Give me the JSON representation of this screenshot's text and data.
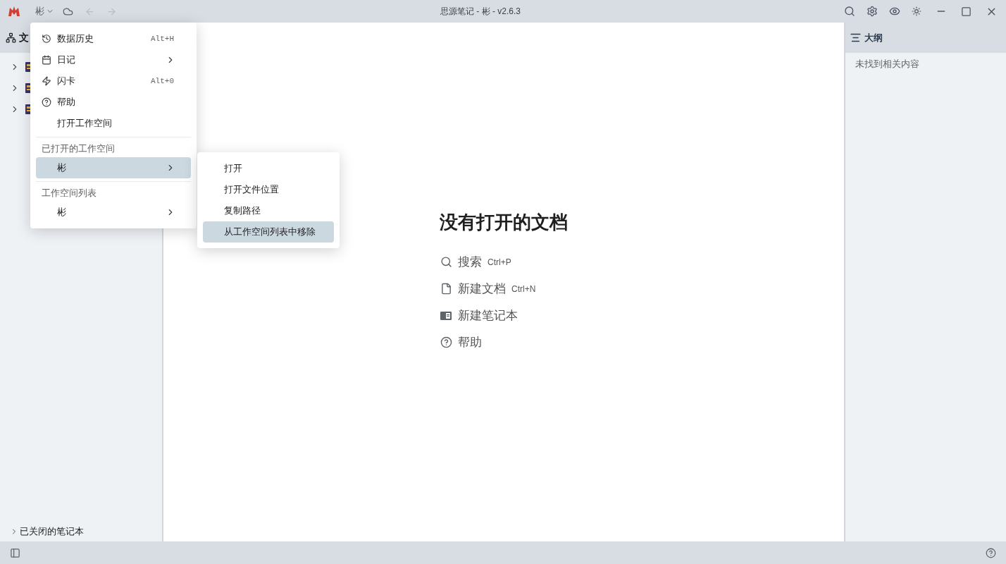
{
  "titlebar": {
    "workspace": "彬",
    "title": "思源笔记 - 彬 - v2.6.3"
  },
  "sidebar": {
    "header": "文",
    "notebooks": [
      {
        "expanded": false
      },
      {
        "expanded": false
      },
      {
        "expanded": false
      }
    ],
    "closed": {
      "label": "已关闭的笔记本",
      "expanded": false
    }
  },
  "main": {
    "heading": "没有打开的文档",
    "actions": [
      {
        "label": "搜索",
        "shortcut": "Ctrl+P"
      },
      {
        "label": "新建文档",
        "shortcut": "Ctrl+N"
      },
      {
        "label": "新建笔记本"
      },
      {
        "label": "帮助"
      }
    ]
  },
  "outline": {
    "title": "大纲",
    "empty": "未找到相关内容"
  },
  "menu": {
    "items": [
      {
        "kind": "item",
        "label": "数据历史",
        "shortcut": "Alt+H",
        "submenu": false,
        "selected": false
      },
      {
        "kind": "item",
        "label": "日记",
        "submenu": true,
        "selected": false
      },
      {
        "kind": "item",
        "label": "闪卡",
        "shortcut": "Alt+0",
        "submenu": false,
        "selected": false
      },
      {
        "kind": "item",
        "label": "帮助",
        "submenu": false,
        "selected": false
      },
      {
        "kind": "item",
        "label": "打开工作空间",
        "submenu": false,
        "selected": false
      },
      {
        "kind": "separator"
      },
      {
        "kind": "header",
        "label": "已打开的工作空间"
      },
      {
        "kind": "item",
        "label": "彬",
        "submenu": true,
        "selected": true
      },
      {
        "kind": "separator"
      },
      {
        "kind": "header",
        "label": "工作空间列表"
      },
      {
        "kind": "item",
        "label": "彬",
        "submenu": true,
        "selected": false
      }
    ]
  },
  "submenu": {
    "items": [
      {
        "label": "打开",
        "selected": false
      },
      {
        "label": "打开文件位置",
        "selected": false
      },
      {
        "label": "复制路径",
        "selected": false
      },
      {
        "label": "从工作空间列表中移除",
        "selected": true
      }
    ]
  }
}
